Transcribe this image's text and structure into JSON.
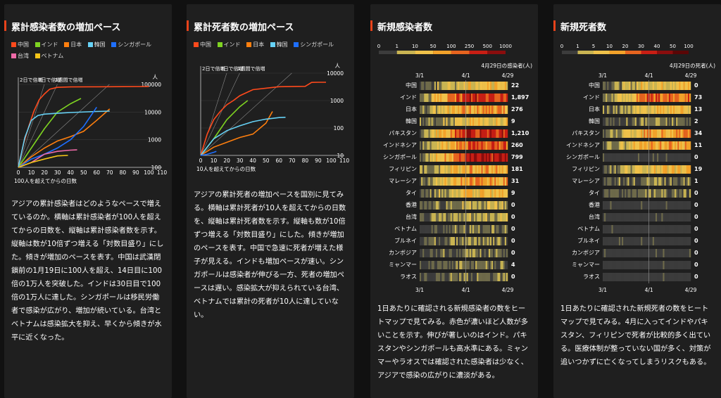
{
  "colors": {
    "china": "#ff4a1c",
    "india": "#7ed321",
    "japan": "#ff7f0e",
    "korea": "#66d1f5",
    "singapore": "#1e6fff",
    "taiwan": "#f06aa8",
    "vietnam": "#f5c518"
  },
  "panels": [
    {
      "title": "累計感染者数の増加ペース",
      "legend": [
        {
          "label": "中国",
          "color": "#ff4a1c"
        },
        {
          "label": "インド",
          "color": "#7ed321"
        },
        {
          "label": "日本",
          "color": "#ff7f0e"
        },
        {
          "label": "韓国",
          "color": "#66d1f5"
        },
        {
          "label": "シンガポール",
          "color": "#1e6fff"
        },
        {
          "label": "台湾",
          "color": "#f06aa8"
        },
        {
          "label": "ベトナム",
          "color": "#f5c518"
        }
      ],
      "description": "アジアの累計感染者はどのようなペースで増えているのか。横軸は累計感染者が100人を超えてからの日数を、縦軸は累計感染者数を示す。縦軸は数が10倍ずつ増える「対数目盛り」にした。傾きが増加のペースを表す。中国は武漢閉鎖前の1月19日に100人を超え、14日目に100倍の1万人を突破した。インドは30日目で100倍の1万人に達した。シンガポールは移民労働者で感染が広がり、増加が続いている。台湾とベトナムは感染拡大を抑え、早くから傾きが水平に近くなった。"
    },
    {
      "title": "累計死者数の増加ペース",
      "legend": [
        {
          "label": "中国",
          "color": "#ff4a1c"
        },
        {
          "label": "インド",
          "color": "#7ed321"
        },
        {
          "label": "日本",
          "color": "#ff7f0e"
        },
        {
          "label": "韓国",
          "color": "#66d1f5"
        },
        {
          "label": "シンガポール",
          "color": "#1e6fff"
        }
      ],
      "description": "アジアの累計死者の増加ペースを国別に見てみる。横軸は累計死者が10人を超えてからの日数を、縦軸は累計死者数を示す。縦軸も数が10倍ずつ増える「対数目盛り」にした。傾きが増加のペースを表す。中国で急速に死者が増えた様子が見える。インドも増加ペースが速い。シンガポールは感染者が伸びる一方、死者の増加ペースは遅い。感染拡大が抑えられている台湾、ベトナムでは累計の死者が10人に達していない。"
    },
    {
      "title": "新規感染者数",
      "scale_ticks": [
        "0",
        "1",
        "10",
        "50",
        "100",
        "250",
        "500",
        "1000"
      ],
      "caption": "4月29日の感染者(人)",
      "dates": [
        "3/1",
        "4/1",
        "4/29"
      ],
      "countries": [
        "中国",
        "インド",
        "日本",
        "韓国",
        "パキスタン",
        "インドネシア",
        "シンガポール",
        "フィリピン",
        "マレーシア",
        "タイ",
        "香港",
        "台湾",
        "ベトナム",
        "ブルネイ",
        "カンボジア",
        "ミャンマー",
        "ラオス"
      ],
      "values": [
        "22",
        "1,897",
        "276",
        "9",
        "1,210",
        "260",
        "799",
        "181",
        "31",
        "9",
        "0",
        "0",
        "0",
        "0",
        "0",
        "4",
        "0"
      ],
      "description": "1日あたりに確認される新規感染者の数をヒートマップで見てみる。赤色が濃いほど人数が多いことを示す。伸びが著しいのはインド。パキスタンやシンガポールも高水準にある。ミャンマーやラオスでは確認された感染者は少なく、アジアで感染の広がりに濃淡がある。"
    },
    {
      "title": "新規死者数",
      "scale_ticks": [
        "0",
        "1",
        "5",
        "10",
        "20",
        "30",
        "40",
        "50",
        "100"
      ],
      "caption": "4月29日の死者(人)",
      "dates": [
        "3/1",
        "4/1",
        "4/29"
      ],
      "countries": [
        "中国",
        "インド",
        "日本",
        "韓国",
        "パキスタン",
        "インドネシア",
        "シンガポール",
        "フィリピン",
        "マレーシア",
        "タイ",
        "香港",
        "台湾",
        "ベトナム",
        "ブルネイ",
        "カンボジア",
        "ミャンマー",
        "ラオス"
      ],
      "values": [
        "0",
        "73",
        "13",
        "2",
        "34",
        "11",
        "0",
        "19",
        "1",
        "0",
        "0",
        "0",
        "0",
        "0",
        "0",
        "0",
        "0"
      ],
      "description": "1日あたりに確認された新規死者の数をヒートマップで見てみる。4月に入ってインドやパキスタン、フィリピンで死者が比較的多く出ている。医療体制が整っていない国が多く、対策が追いつかずに亡くなってしまうリスクもある。"
    }
  ],
  "chart_data": [
    {
      "type": "line",
      "title": "累計感染者数の増加ペース",
      "xlabel": "100人を超えてからの日数",
      "ylabel": "人",
      "y_scale": "log",
      "xlim": [
        0,
        110
      ],
      "ylim": [
        100,
        100000
      ],
      "x_ticks": [
        "0",
        "10",
        "20",
        "30",
        "40",
        "50",
        "60",
        "70",
        "80",
        "90",
        "100",
        "110"
      ],
      "y_ticks": [
        "100",
        "1000",
        "10000",
        "100000"
      ],
      "guide_labels": [
        "2日で倍増",
        "3日で倍増",
        "1週間で倍増"
      ],
      "series": [
        {
          "name": "中国",
          "x": [
            0,
            4,
            8,
            12,
            16,
            20,
            24,
            30,
            40,
            60,
            80,
            100
          ],
          "y": [
            100,
            700,
            3000,
            11000,
            28000,
            45000,
            67000,
            78000,
            81000,
            82000,
            83000,
            84000
          ]
        },
        {
          "name": "インド",
          "x": [
            0,
            10,
            20,
            30,
            40,
            48
          ],
          "y": [
            100,
            500,
            2500,
            10000,
            20000,
            31000
          ]
        },
        {
          "name": "日本",
          "x": [
            0,
            10,
            20,
            30,
            40,
            50,
            60,
            70
          ],
          "y": [
            100,
            240,
            500,
            900,
            1300,
            2000,
            5000,
            13000
          ]
        },
        {
          "name": "韓国",
          "x": [
            0,
            5,
            10,
            15,
            20,
            30,
            40,
            60,
            70
          ],
          "y": [
            100,
            1200,
            5000,
            7500,
            8400,
            9000,
            9600,
            10500,
            10800
          ]
        },
        {
          "name": "シンガポール",
          "x": [
            0,
            10,
            20,
            30,
            40,
            50,
            60
          ],
          "y": [
            100,
            200,
            300,
            500,
            1000,
            3000,
            15000
          ]
        },
        {
          "name": "台湾",
          "x": [
            0,
            10,
            20,
            30,
            40,
            45
          ],
          "y": [
            100,
            150,
            300,
            380,
            420,
            430
          ]
        },
        {
          "name": "ベトナム",
          "x": [
            0,
            10,
            20,
            30,
            38
          ],
          "y": [
            100,
            150,
            200,
            260,
            270
          ]
        }
      ]
    },
    {
      "type": "line",
      "title": "累計死者数の増加ペース",
      "xlabel": "10人を超えてからの日数",
      "ylabel": "人",
      "y_scale": "log",
      "xlim": [
        0,
        110
      ],
      "ylim": [
        10,
        10000
      ],
      "x_ticks": [
        "0",
        "10",
        "20",
        "30",
        "40",
        "50",
        "60",
        "70",
        "80",
        "90",
        "100",
        "110"
      ],
      "y_ticks": [
        "10",
        "100",
        "1000",
        "10000"
      ],
      "guide_labels": [
        "2日で倍増",
        "3日で倍増",
        "1週間で倍増"
      ],
      "series": [
        {
          "name": "中国",
          "x": [
            0,
            5,
            10,
            15,
            20,
            25,
            30,
            40,
            60,
            80,
            85,
            90,
            96
          ],
          "y": [
            10,
            60,
            200,
            400,
            700,
            1000,
            1500,
            2500,
            3200,
            3300,
            4600,
            4630,
            4640
          ]
        },
        {
          "name": "インド",
          "x": [
            0,
            10,
            20,
            30,
            36
          ],
          "y": [
            10,
            40,
            200,
            600,
            1000
          ]
        },
        {
          "name": "日本",
          "x": [
            0,
            10,
            20,
            30,
            40,
            50,
            55
          ],
          "y": [
            10,
            20,
            30,
            45,
            60,
            150,
            400
          ]
        },
        {
          "name": "韓国",
          "x": [
            0,
            10,
            20,
            30,
            40,
            50,
            60,
            65
          ],
          "y": [
            10,
            40,
            80,
            120,
            170,
            210,
            240,
            245
          ]
        },
        {
          "name": "シンガポール",
          "x": [
            0,
            5,
            10,
            12
          ],
          "y": [
            10,
            11,
            13,
            14
          ]
        }
      ]
    },
    {
      "type": "heatmap",
      "title": "新規感染者数",
      "x_range": [
        "3/1",
        "4/29"
      ],
      "legend_scale": [
        0,
        1,
        10,
        50,
        100,
        250,
        500,
        1000
      ],
      "rows": [
        "中国",
        "インド",
        "日本",
        "韓国",
        "パキスタン",
        "インドネシア",
        "シンガポール",
        "フィリピン",
        "マレーシア",
        "タイ",
        "香港",
        "台湾",
        "ベトナム",
        "ブルネイ",
        "カンボジア",
        "ミャンマー",
        "ラオス"
      ],
      "values_4_29": [
        22,
        1897,
        276,
        9,
        1210,
        260,
        799,
        181,
        31,
        9,
        0,
        0,
        0,
        0,
        0,
        4,
        0
      ],
      "intensity": [
        3,
        6,
        4,
        3,
        6,
        5,
        6,
        4,
        4,
        3,
        2,
        2,
        1,
        1,
        1,
        1,
        1
      ]
    },
    {
      "type": "heatmap",
      "title": "新規死者数",
      "x_range": [
        "3/1",
        "4/29"
      ],
      "legend_scale": [
        0,
        1,
        5,
        10,
        20,
        30,
        40,
        50,
        100
      ],
      "rows": [
        "中国",
        "インド",
        "日本",
        "韓国",
        "パキスタン",
        "インドネシア",
        "シンガポール",
        "フィリピン",
        "マレーシア",
        "タイ",
        "香港",
        "台湾",
        "ベトナム",
        "ブルネイ",
        "カンボジア",
        "ミャンマー",
        "ラオス"
      ],
      "values_4_29": [
        0,
        73,
        13,
        2,
        34,
        11,
        0,
        19,
        1,
        0,
        0,
        0,
        0,
        0,
        0,
        0,
        0
      ],
      "intensity": [
        3,
        5,
        3,
        1,
        4,
        4,
        0,
        3,
        1,
        1,
        0,
        0,
        0,
        0,
        0,
        0,
        0
      ]
    }
  ]
}
